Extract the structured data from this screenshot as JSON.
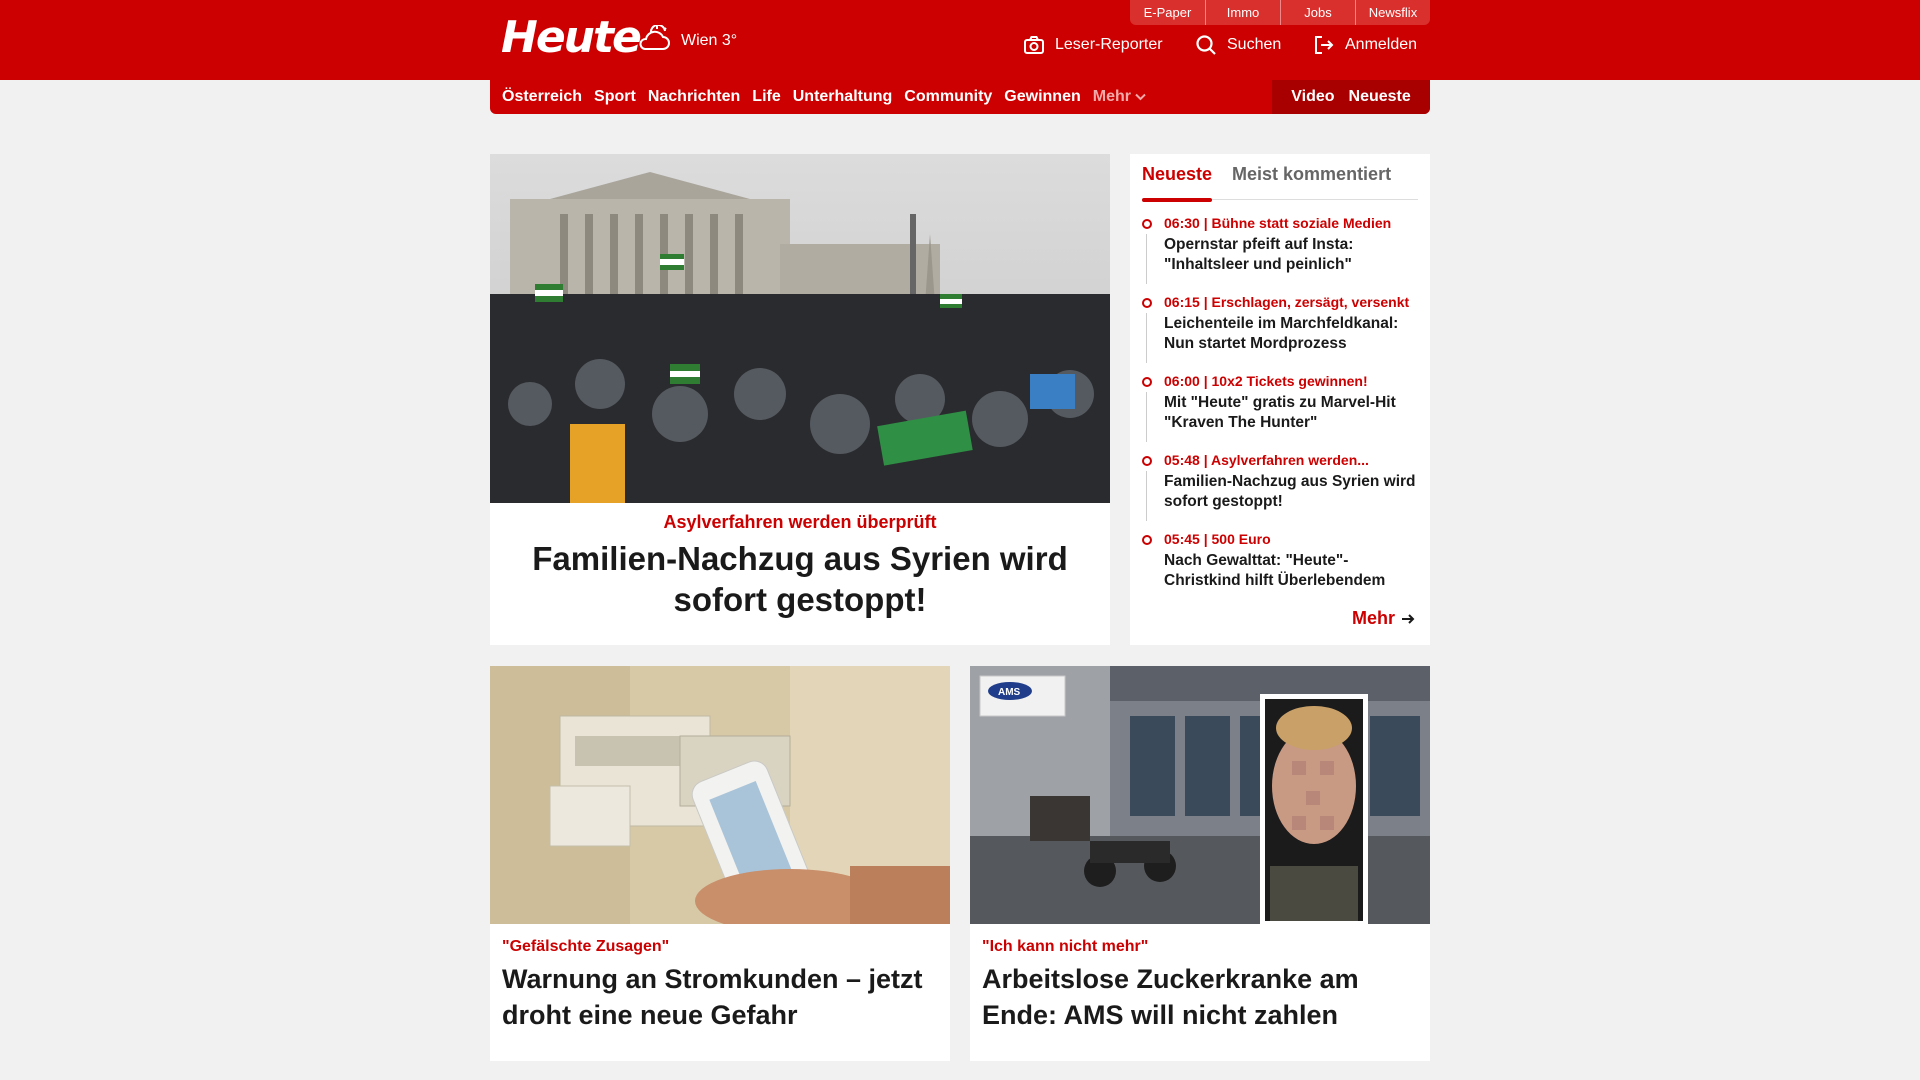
{
  "brand": {
    "logo": "Heute",
    "weather": "Wien 3°"
  },
  "top_links": [
    "E-Paper",
    "Immo",
    "Jobs",
    "Newsflix"
  ],
  "header_actions": {
    "reporter": "Leser-Reporter",
    "search": "Suchen",
    "login": "Anmelden"
  },
  "nav": {
    "items": [
      "Österreich",
      "Sport",
      "Nachrichten",
      "Life",
      "Unterhaltung",
      "Community",
      "Gewinnen"
    ],
    "more": "Mehr",
    "video": "Video",
    "latest": "Neueste"
  },
  "hero": {
    "kicker": "Asylverfahren werden überprüft",
    "title": "Familien-Nachzug aus Syrien wird sofort gestoppt!"
  },
  "sidebar": {
    "tabs": [
      "Neueste",
      "Meist kommentiert"
    ],
    "items": [
      {
        "meta": "06:30 | Bühne statt soziale Medien",
        "headline": "Opernstar pfeift auf Insta: \"Inhaltsleer und peinlich\""
      },
      {
        "meta": "06:15 | Erschlagen, zersägt, versenkt",
        "headline": "Leichenteile im Marchfeldkanal: Nun startet Mordprozess"
      },
      {
        "meta": "06:00 | 10x2 Tickets gewinnen!",
        "headline": "Mit \"Heute\" gratis zu Marvel-Hit \"Kraven The Hunter\""
      },
      {
        "meta": "05:48 | Asylverfahren werden...",
        "headline": "Familien-Nachzug aus Syrien wird sofort gestoppt!"
      },
      {
        "meta": "05:45 | 500 Euro",
        "headline": "Nach Gewalttat: \"Heute\"-Christkind hilft Überlebendem"
      }
    ],
    "more": "Mehr"
  },
  "cards": [
    {
      "kicker": "\"Gefälschte Zusagen\"",
      "title": "Warnung an Stromkunden – jetzt droht eine neue Gefahr"
    },
    {
      "kicker": "\"Ich kann nicht mehr\"",
      "title": "Arbeitslose Zuckerkranke am Ende: AMS will nicht zahlen"
    }
  ],
  "ams_sign": "AMS",
  "colors": {
    "brand_red": "#cc0000",
    "dark_red": "#a80000",
    "background": "#f1f1f1"
  }
}
